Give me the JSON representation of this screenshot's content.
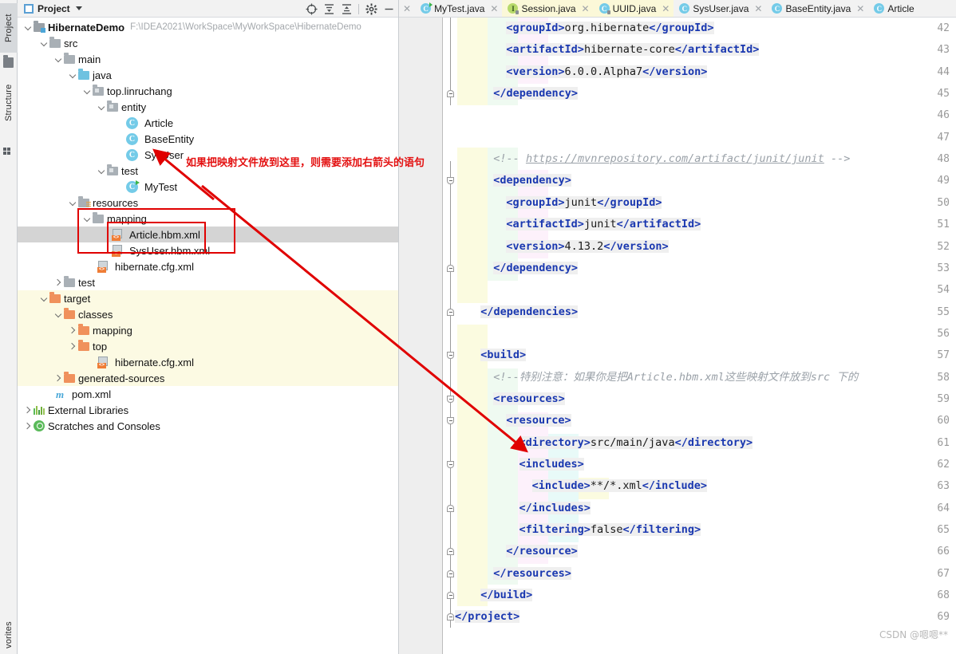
{
  "toolstrip": {
    "tabs": [
      {
        "label": "Project",
        "active": true,
        "icon": "folder-icon"
      },
      {
        "label": "Structure",
        "active": false,
        "icon": "structure-icon"
      },
      {
        "label": "vorites",
        "active": false,
        "icon": "star-icon"
      }
    ]
  },
  "project_panel": {
    "title": "Project",
    "dropdown_icon": "chevron-down-icon",
    "toolbar": [
      {
        "name": "locate-icon",
        "glyph": "target"
      },
      {
        "name": "expand-all-icon",
        "glyph": "expand"
      },
      {
        "name": "collapse-all-icon",
        "glyph": "collapse"
      },
      {
        "name": "settings-gear-icon",
        "glyph": "gear"
      },
      {
        "name": "hide-panel-icon",
        "glyph": "minus"
      }
    ],
    "tree": [
      {
        "label": "HibernateDemo",
        "path": "F:\\IDEA2021\\WorkSpace\\MyWorkSpace\\HibernateDemo",
        "depth": 0,
        "icon": "module-icon",
        "expanded": true,
        "bold": true
      },
      {
        "label": "src",
        "depth": 1,
        "icon": "folder-icon",
        "expanded": true
      },
      {
        "label": "main",
        "depth": 2,
        "icon": "folder-icon",
        "expanded": true
      },
      {
        "label": "java",
        "depth": 3,
        "icon": "source-folder-icon",
        "expanded": true
      },
      {
        "label": "top.linruchang",
        "depth": 4,
        "icon": "package-icon",
        "expanded": true
      },
      {
        "label": "entity",
        "depth": 5,
        "icon": "package-icon",
        "expanded": true
      },
      {
        "label": "Article",
        "depth": 6,
        "icon": "java-class-icon"
      },
      {
        "label": "BaseEntity",
        "depth": 6,
        "icon": "java-class-icon"
      },
      {
        "label": "SysUser",
        "depth": 6,
        "icon": "java-class-icon"
      },
      {
        "label": "test",
        "depth": 5,
        "icon": "package-icon",
        "expanded": true
      },
      {
        "label": "MyTest",
        "depth": 6,
        "icon": "java-runnable-class-icon"
      },
      {
        "label": "resources",
        "depth": 3,
        "icon": "resources-folder-icon",
        "expanded": true
      },
      {
        "label": "mapping",
        "depth": 4,
        "icon": "folder-icon",
        "expanded": true
      },
      {
        "label": "Article.hbm.xml",
        "depth": 5,
        "icon": "xml-file-icon",
        "selected": true
      },
      {
        "label": "SysUser.hbm.xml",
        "depth": 5,
        "icon": "xml-file-icon"
      },
      {
        "label": "hibernate.cfg.xml",
        "depth": 4,
        "icon": "xml-file-icon"
      },
      {
        "label": "test",
        "depth": 2,
        "icon": "folder-icon",
        "collapsed": true
      },
      {
        "label": "target",
        "depth": 1,
        "icon": "target-folder-icon",
        "expanded": true,
        "excluded": true
      },
      {
        "label": "classes",
        "depth": 2,
        "icon": "target-folder-icon",
        "expanded": true,
        "excluded": true
      },
      {
        "label": "mapping",
        "depth": 3,
        "icon": "target-folder-icon",
        "collapsed": true,
        "excluded": true
      },
      {
        "label": "top",
        "depth": 3,
        "icon": "target-folder-icon",
        "collapsed": true,
        "excluded": true
      },
      {
        "label": "hibernate.cfg.xml",
        "depth": 3,
        "icon": "xml-file-icon",
        "excluded": true
      },
      {
        "label": "generated-sources",
        "depth": 2,
        "icon": "target-folder-icon",
        "collapsed": true,
        "excluded": true
      },
      {
        "label": "pom.xml",
        "depth": 1,
        "icon": "maven-icon"
      },
      {
        "label": "External Libraries",
        "depth": 0,
        "icon": "library-icon",
        "collapsed": true
      },
      {
        "label": "Scratches and Consoles",
        "depth": 0,
        "icon": "scratches-icon"
      }
    ]
  },
  "annotations": {
    "note_text": "如果把映射文件放到这里，则需要添加右箭头的语句",
    "box_color": "#e00000",
    "text_color": "#e31010"
  },
  "editor": {
    "tabs": [
      {
        "label": "MyTest.java",
        "icon": "java-runnable-class-icon",
        "close_icon": "close-icon",
        "highlight": false
      },
      {
        "label": "Session.java",
        "icon": "java-interface-icon",
        "close_icon": "close-icon",
        "highlight": true
      },
      {
        "label": "UUID.java",
        "icon": "java-class-icon",
        "close_icon": "close-icon",
        "highlight": true
      },
      {
        "label": "SysUser.java",
        "icon": "java-class-icon",
        "close_icon": "close-icon",
        "highlight": false
      },
      {
        "label": "BaseEntity.java",
        "icon": "java-class-icon",
        "close_icon": "close-icon",
        "highlight": false
      },
      {
        "label": "Article",
        "icon": "java-class-icon",
        "close_icon": "close-icon",
        "highlight": false
      }
    ],
    "first_line_number": 42,
    "lines": [
      {
        "n": 42,
        "indent": 8,
        "parts": [
          {
            "t": "<groupId>",
            "k": "tag"
          },
          {
            "t": "org.hibernate",
            "k": "text"
          },
          {
            "t": "</groupId>",
            "k": "tag"
          }
        ]
      },
      {
        "n": 43,
        "indent": 8,
        "parts": [
          {
            "t": "<artifactId>",
            "k": "tag"
          },
          {
            "t": "hibernate-core",
            "k": "text"
          },
          {
            "t": "</artifactId>",
            "k": "tag"
          }
        ]
      },
      {
        "n": 44,
        "indent": 8,
        "parts": [
          {
            "t": "<version>",
            "k": "tag"
          },
          {
            "t": "6.0.0.Alpha7",
            "k": "text"
          },
          {
            "t": "</version>",
            "k": "tag"
          }
        ]
      },
      {
        "n": 45,
        "indent": 6,
        "parts": [
          {
            "t": "</dependency>",
            "k": "tag"
          }
        ]
      },
      {
        "n": 46,
        "indent": 0,
        "parts": []
      },
      {
        "n": 47,
        "indent": 0,
        "parts": []
      },
      {
        "n": 48,
        "indent": 6,
        "parts": [
          {
            "t": "<!-- ",
            "k": "comment"
          },
          {
            "t": "https://mvnrepository.com/artifact/junit/junit",
            "k": "comment-url"
          },
          {
            "t": " -->",
            "k": "comment"
          }
        ]
      },
      {
        "n": 49,
        "indent": 6,
        "parts": [
          {
            "t": "<dependency>",
            "k": "tag"
          }
        ]
      },
      {
        "n": 50,
        "indent": 8,
        "parts": [
          {
            "t": "<groupId>",
            "k": "tag"
          },
          {
            "t": "junit",
            "k": "text"
          },
          {
            "t": "</groupId>",
            "k": "tag"
          }
        ]
      },
      {
        "n": 51,
        "indent": 8,
        "parts": [
          {
            "t": "<artifactId>",
            "k": "tag"
          },
          {
            "t": "junit",
            "k": "text"
          },
          {
            "t": "</artifactId>",
            "k": "tag"
          }
        ]
      },
      {
        "n": 52,
        "indent": 8,
        "parts": [
          {
            "t": "<version>",
            "k": "tag"
          },
          {
            "t": "4.13.2",
            "k": "text"
          },
          {
            "t": "</version>",
            "k": "tag"
          }
        ]
      },
      {
        "n": 53,
        "indent": 6,
        "parts": [
          {
            "t": "</dependency>",
            "k": "tag"
          }
        ]
      },
      {
        "n": 54,
        "indent": 0,
        "parts": []
      },
      {
        "n": 55,
        "indent": 4,
        "parts": [
          {
            "t": "</dependencies>",
            "k": "tag"
          }
        ]
      },
      {
        "n": 56,
        "indent": 0,
        "parts": []
      },
      {
        "n": 57,
        "indent": 4,
        "parts": [
          {
            "t": "<build>",
            "k": "tag"
          }
        ]
      },
      {
        "n": 58,
        "indent": 6,
        "parts": [
          {
            "t": "<!--特别注意：如果你是把Article.hbm.xml这些映射文件放到src 下的",
            "k": "comment"
          }
        ]
      },
      {
        "n": 59,
        "indent": 6,
        "parts": [
          {
            "t": "<resources>",
            "k": "tag"
          }
        ]
      },
      {
        "n": 60,
        "indent": 8,
        "parts": [
          {
            "t": "<resource>",
            "k": "tag"
          }
        ]
      },
      {
        "n": 61,
        "indent": 10,
        "parts": [
          {
            "t": "<directory>",
            "k": "tag"
          },
          {
            "t": "src/main/java",
            "k": "text"
          },
          {
            "t": "</directory>",
            "k": "tag"
          }
        ]
      },
      {
        "n": 62,
        "indent": 10,
        "parts": [
          {
            "t": "<includes>",
            "k": "tag"
          }
        ]
      },
      {
        "n": 63,
        "indent": 12,
        "parts": [
          {
            "t": "<include>",
            "k": "tag"
          },
          {
            "t": "**/*.xml",
            "k": "text"
          },
          {
            "t": "</include>",
            "k": "tag"
          }
        ]
      },
      {
        "n": 64,
        "indent": 10,
        "parts": [
          {
            "t": "</includes>",
            "k": "tag"
          }
        ]
      },
      {
        "n": 65,
        "indent": 10,
        "parts": [
          {
            "t": "<filtering>",
            "k": "tag"
          },
          {
            "t": "false",
            "k": "text"
          },
          {
            "t": "</filtering>",
            "k": "tag"
          }
        ]
      },
      {
        "n": 66,
        "indent": 8,
        "parts": [
          {
            "t": "</resource>",
            "k": "tag"
          }
        ]
      },
      {
        "n": 67,
        "indent": 6,
        "parts": [
          {
            "t": "</resources>",
            "k": "tag"
          }
        ]
      },
      {
        "n": 68,
        "indent": 4,
        "parts": [
          {
            "t": "</build>",
            "k": "tag"
          }
        ]
      },
      {
        "n": 69,
        "indent": 0,
        "parts": [
          {
            "t": "</project>",
            "k": "tag"
          }
        ]
      }
    ],
    "watermark": "CSDN @嗯嗯**"
  }
}
